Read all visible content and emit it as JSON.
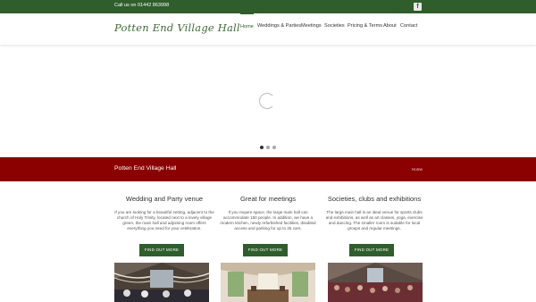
{
  "topbar": {
    "call": "Call us on 01442 863998",
    "social_icon": "facebook-icon"
  },
  "header": {
    "logo": "Potten End Village Hall",
    "nav": [
      {
        "label": "Home",
        "active": true
      },
      {
        "label": "Weddings & Parties",
        "active": false
      },
      {
        "label": "Meetings",
        "active": false
      },
      {
        "label": "Societies",
        "active": false
      },
      {
        "label": "Pricing & Terms",
        "active": false
      },
      {
        "label": "About",
        "active": false
      },
      {
        "label": "Contact",
        "active": false
      }
    ]
  },
  "slider": {
    "slide_count": 3,
    "active_slide": 1
  },
  "banner": {
    "title": "Potten End Village Hall",
    "breadcrumb": "Home"
  },
  "columns": [
    {
      "heading": "Wedding and Party venue",
      "text": "If you are looking for a beautiful setting, adjacent to the church of Holy Trinity, located next to a lovely village green, the main hall and adjoining room offers everything you need for your celebration.",
      "button": "FIND OUT MORE"
    },
    {
      "heading": "Great for meetings",
      "text": "If you require space, the large main hall can accommodate 150 people. In addition, we have a modern kitchen, newly refurbished facilities, disabled access and parking for up to 25 cars.",
      "button": "FIND OUT MORE"
    },
    {
      "heading": "Societies, clubs and exhibitions",
      "text": "The large main hall is an ideal venue for sports clubs and exhibitions, as well as art classes, yoga, exercise and dancing. The smaller room is suitable for local groups and regular meetings.",
      "button": "FIND OUT MORE"
    }
  ],
  "colors": {
    "brand_green": "#2f5e2c",
    "banner_red": "#8b0000"
  }
}
